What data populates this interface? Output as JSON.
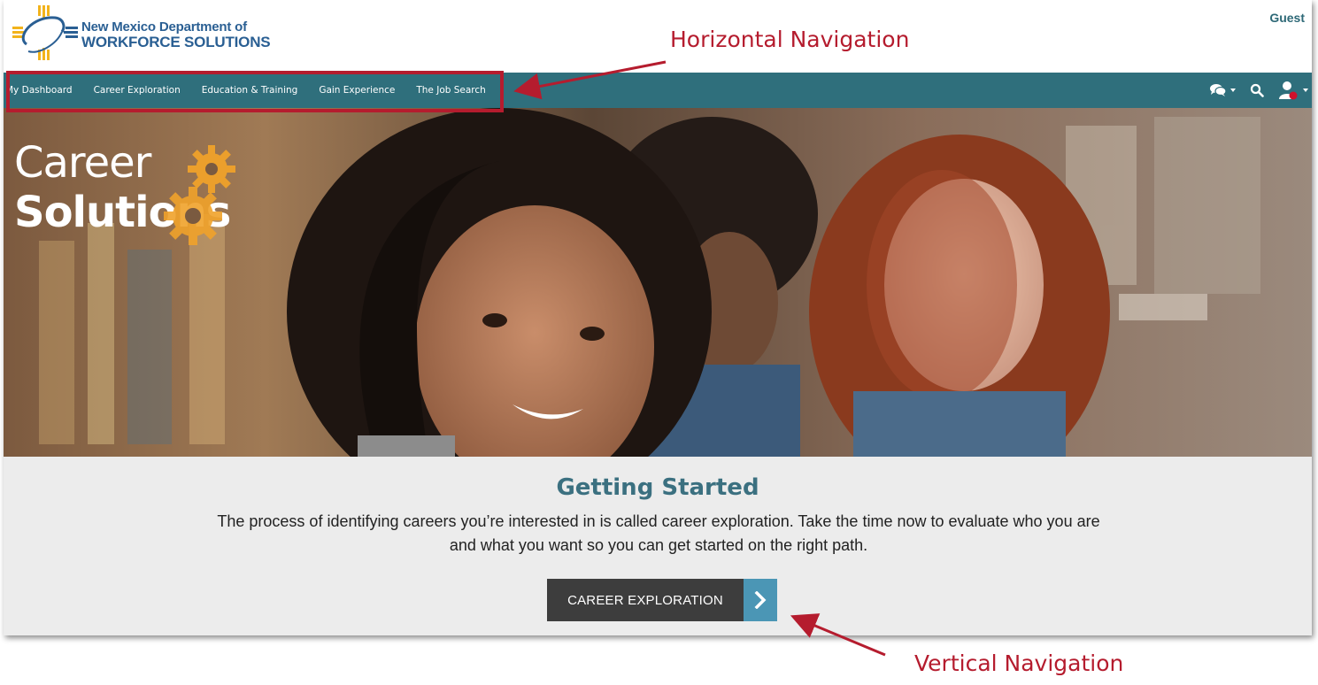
{
  "header": {
    "logo_line1": "New Mexico Department of",
    "logo_line2": "WORKFORCE SOLUTIONS",
    "user_label": "Guest"
  },
  "nav": {
    "items": [
      {
        "label": "My Dashboard"
      },
      {
        "label": "Career Exploration"
      },
      {
        "label": "Education & Training"
      },
      {
        "label": "Gain Experience"
      },
      {
        "label": "The Job Search"
      }
    ],
    "tools": [
      "chat-icon",
      "search-icon",
      "user-icon"
    ]
  },
  "hero": {
    "brand_line1": "Career",
    "brand_line2": "Solutions"
  },
  "getting_started": {
    "title": "Getting Started",
    "body": "The process of identifying careers you’re interested in is called career exploration. Take the time now to evaluate who you are and what you want so you can get started on the right path.",
    "button_label": "CAREER EXPLORATION"
  },
  "annotations": {
    "horizontal": "Horizontal Navigation",
    "vertical": "Vertical Navigation"
  },
  "colors": {
    "nav_bar": "#2f6f7c",
    "annotation": "#b51c2e",
    "title": "#3b7080",
    "button_dark": "#3d3d3d",
    "button_accent": "#4b96b5",
    "gear": "#f0a22b"
  }
}
